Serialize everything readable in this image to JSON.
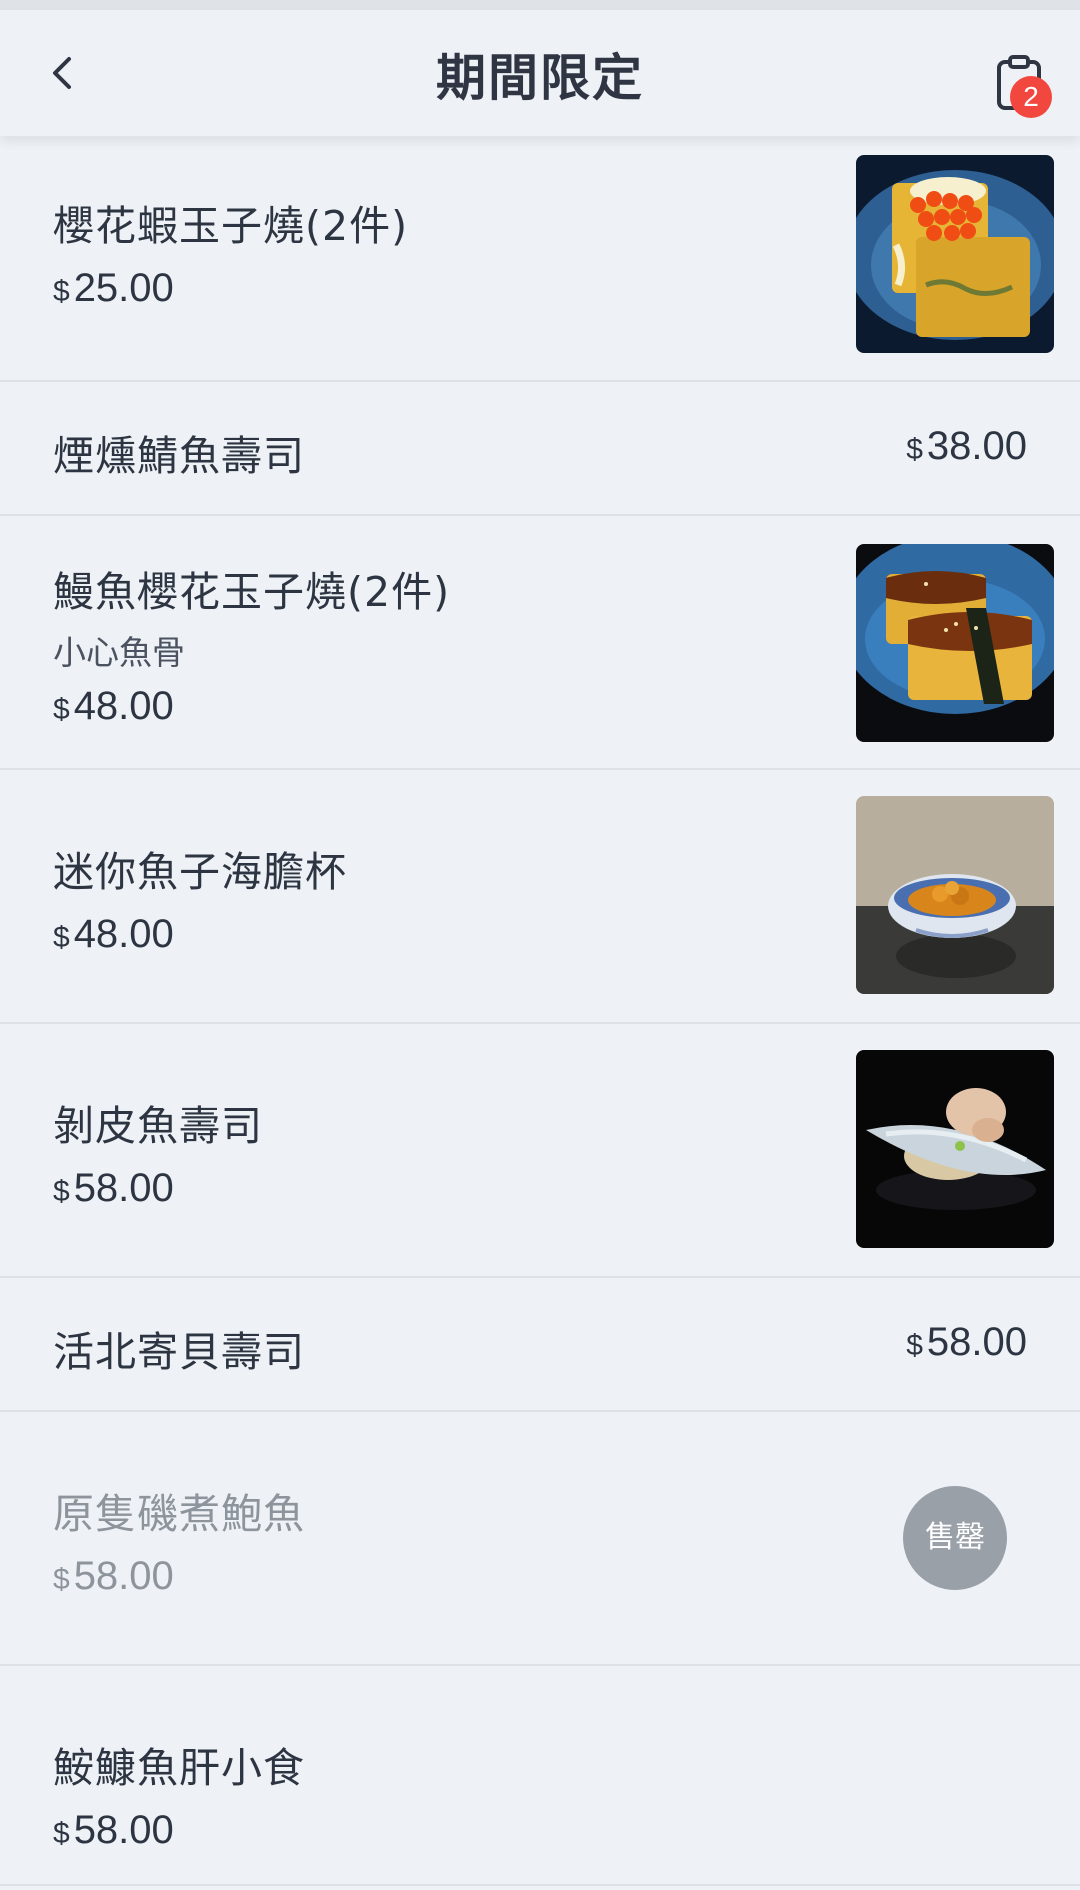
{
  "header": {
    "title": "期間限定",
    "back_icon": "chevron-left-icon",
    "cart_icon": "clipboard-icon",
    "cart_count": "2"
  },
  "currency": "$",
  "items": [
    {
      "name": "櫻花蝦玉子燒(2件)",
      "price": "25.00",
      "image": "tamagoyaki-with-roe"
    },
    {
      "name": "煙燻鯖魚壽司",
      "price": "38.00"
    },
    {
      "name": "鰻魚櫻花玉子燒(2件)",
      "note": "小心魚骨",
      "price": "48.00",
      "image": "eel-tamagoyaki"
    },
    {
      "name": "迷你魚子海膽杯",
      "price": "48.00",
      "image": "sea-urchin-cup"
    },
    {
      "name": "剝皮魚壽司",
      "price": "58.00",
      "image": "filefish-sushi"
    },
    {
      "name": "活北寄貝壽司",
      "price": "58.00"
    },
    {
      "name": "原隻磯煮鮑魚",
      "price": "58.00",
      "status": "售罄"
    },
    {
      "name": "鮟鱇魚肝小食",
      "price": "58.00"
    }
  ],
  "colors": {
    "background": "#eef2f6",
    "text": "#2e3542",
    "muted": "#8e949c",
    "badge": "#f2473f",
    "soldout": "#9aa0a8"
  }
}
